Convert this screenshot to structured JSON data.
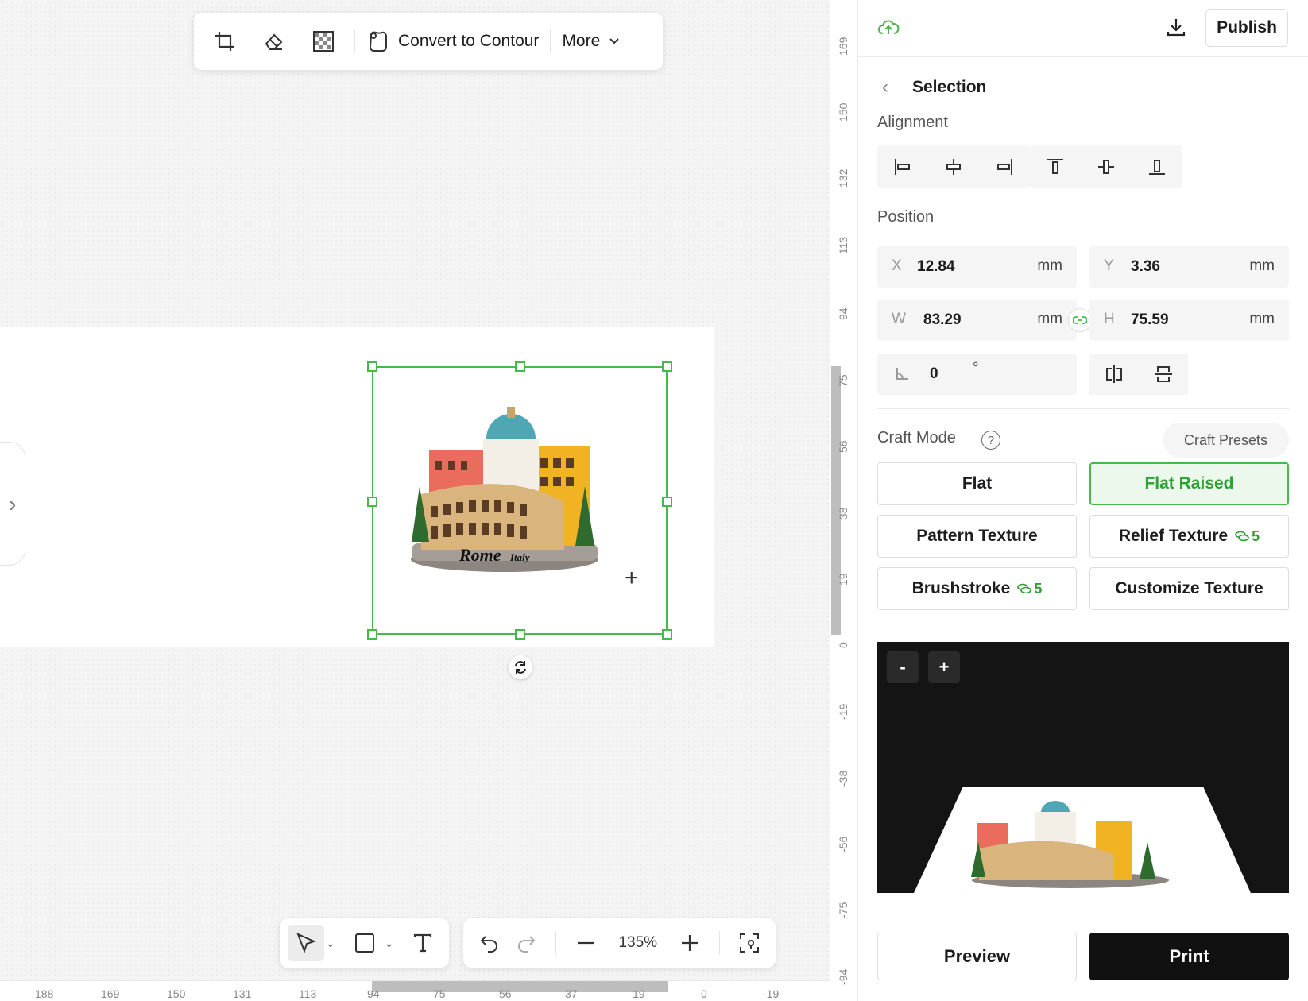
{
  "toolbar": {
    "crop_icon": "crop-icon",
    "eraser_icon": "eraser-icon",
    "transparency_icon": "checkerboard-icon",
    "convert_label": "Convert to Contour",
    "more_label": "More"
  },
  "image": {
    "caption_main": "Rome",
    "caption_sub": "Italy"
  },
  "bottom_toolbar": {
    "zoom": "135%"
  },
  "ruler_vertical": [
    "169",
    "150",
    "132",
    "113",
    "94",
    "75",
    "56",
    "38",
    "19",
    "0",
    "-19",
    "-38",
    "-56",
    "-75",
    "-94"
  ],
  "ruler_horizontal": [
    "188",
    "169",
    "150",
    "131",
    "113",
    "94",
    "75",
    "56",
    "37",
    "19",
    "0",
    "-19"
  ],
  "header": {
    "publish_label": "Publish"
  },
  "panel": {
    "title": "Selection",
    "alignment_label": "Alignment",
    "position_label": "Position",
    "x": {
      "key": "X",
      "value": "12.84",
      "unit": "mm"
    },
    "y": {
      "key": "Y",
      "value": "3.36",
      "unit": "mm"
    },
    "w": {
      "key": "W",
      "value": "83.29",
      "unit": "mm"
    },
    "h": {
      "key": "H",
      "value": "75.59",
      "unit": "mm"
    },
    "rotation": {
      "value": "0",
      "unit": "°"
    },
    "craft_mode_label": "Craft Mode",
    "help": "?",
    "craft_presets_label": "Craft Presets",
    "modes": {
      "flat": "Flat",
      "flat_raised": "Flat Raised",
      "pattern_texture": "Pattern Texture",
      "relief_texture": "Relief Texture",
      "relief_cost": "5",
      "brushstroke": "Brushstroke",
      "brushstroke_cost": "5",
      "customize_texture": "Customize Texture"
    },
    "preview_zoom_out": "-",
    "preview_zoom_in": "+",
    "preview_label": "Preview",
    "print_label": "Print"
  },
  "colors": {
    "accent": "#47b84a",
    "dark": "#111111"
  }
}
